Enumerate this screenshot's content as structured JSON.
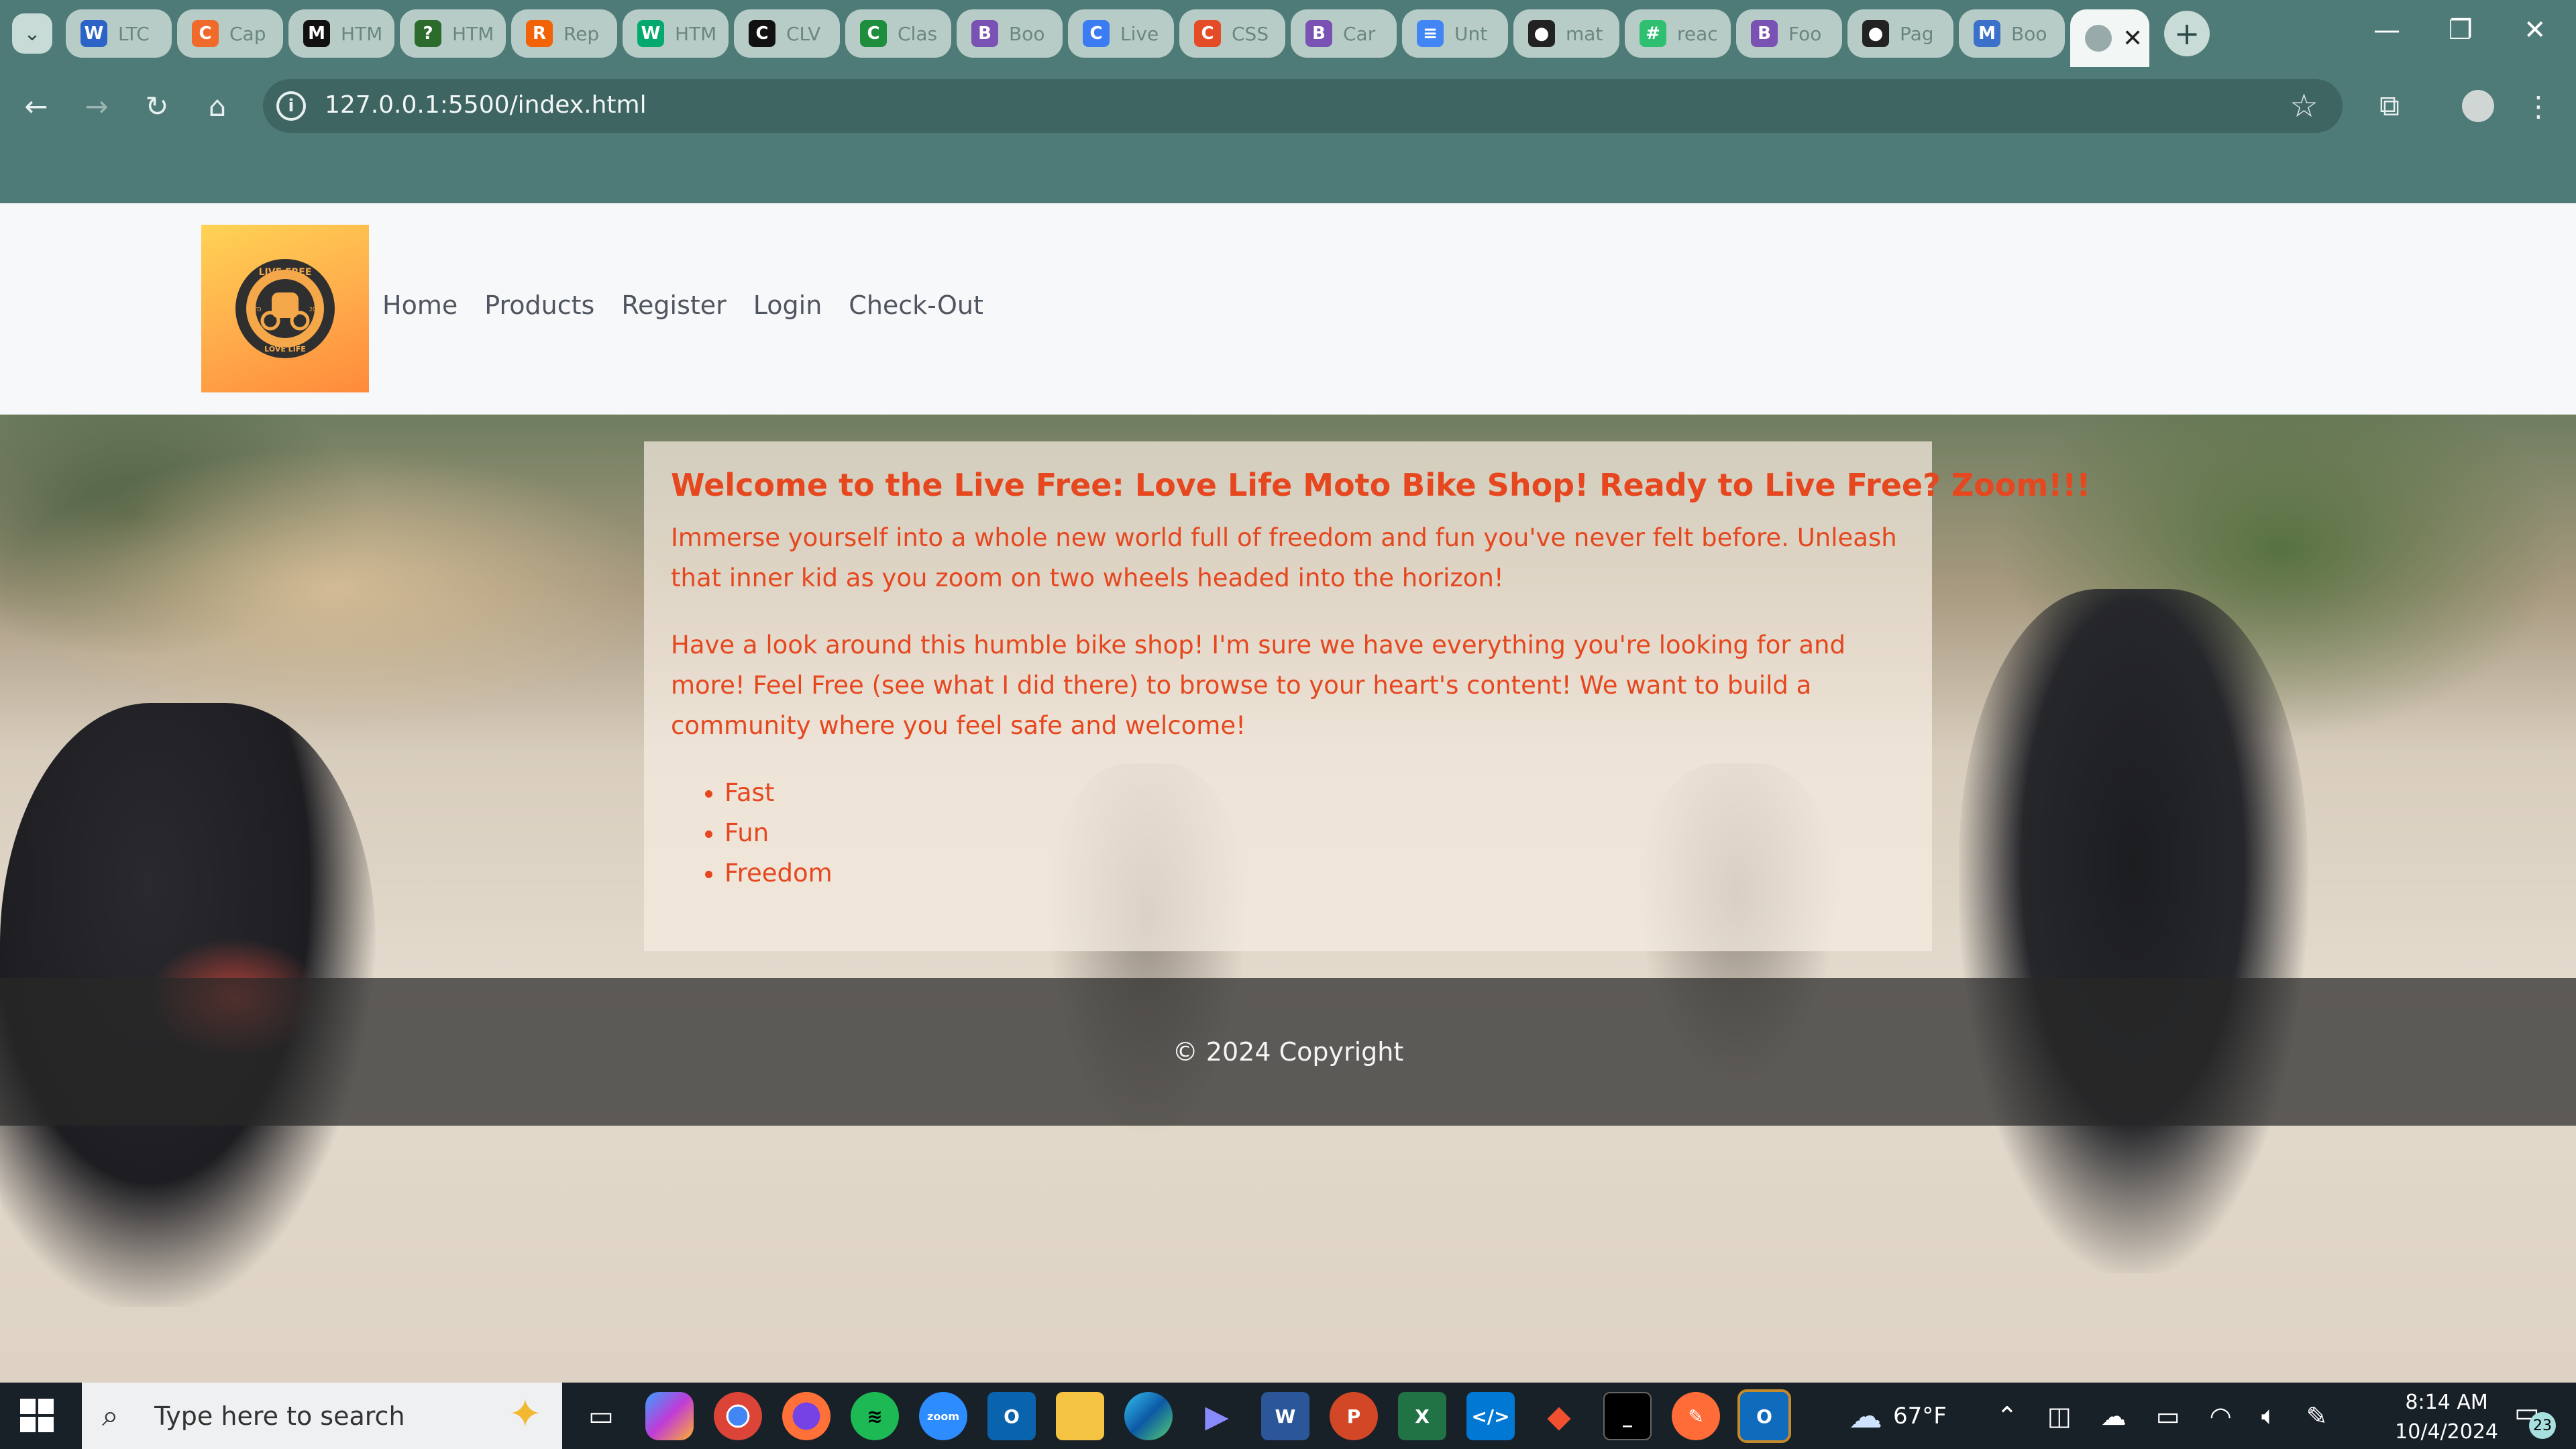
{
  "browser": {
    "tabs": [
      {
        "label": "LTC",
        "icon": "word-icon",
        "color": "#2b63c6",
        "glyph": "W"
      },
      {
        "label": "Cap",
        "icon": "codecademy-icon",
        "color": "#f06a2b",
        "glyph": "C"
      },
      {
        "label": "HTM",
        "icon": "m-icon",
        "color": "#111111",
        "glyph": "M"
      },
      {
        "label": "HTM",
        "icon": "question-icon",
        "color": "#2d6b2d",
        "glyph": "?"
      },
      {
        "label": "Rep",
        "icon": "replit-icon",
        "color": "#f26207",
        "glyph": "R"
      },
      {
        "label": "HTM",
        "icon": "w3schools-icon",
        "color": "#04aa6d",
        "glyph": "W"
      },
      {
        "label": "CLV",
        "icon": "clv-icon",
        "color": "#111111",
        "glyph": "C"
      },
      {
        "label": "Clas",
        "icon": "classroom-icon",
        "color": "#1e8e3e",
        "glyph": "C"
      },
      {
        "label": "Boo",
        "icon": "bootstrap-icon",
        "color": "#7952b3",
        "glyph": "B"
      },
      {
        "label": "Live",
        "icon": "canva-icon",
        "color": "#3c7cf2",
        "glyph": "C"
      },
      {
        "label": "CSS",
        "icon": "css-icon",
        "color": "#e34c26",
        "glyph": "C"
      },
      {
        "label": "Car",
        "icon": "bootstrap-icon",
        "color": "#7952b3",
        "glyph": "B"
      },
      {
        "label": "Unt",
        "icon": "docs-icon",
        "color": "#4285f4",
        "glyph": "≡"
      },
      {
        "label": "mat",
        "icon": "github-icon",
        "color": "#222222",
        "glyph": "●"
      },
      {
        "label": "reac",
        "icon": "react-icon",
        "color": "#2fbf71",
        "glyph": "#"
      },
      {
        "label": "Foo",
        "icon": "bootstrap-icon",
        "color": "#7952b3",
        "glyph": "B"
      },
      {
        "label": "Pag",
        "icon": "github-icon",
        "color": "#222222",
        "glyph": "●"
      },
      {
        "label": "Boo",
        "icon": "mdb-icon",
        "color": "#3b71ca",
        "glyph": "M"
      }
    ],
    "address": "127.0.0.1:5500/index.html"
  },
  "site": {
    "nav": [
      "Home",
      "Products",
      "Register",
      "Login",
      "Check-Out"
    ],
    "logo_text_top": "LIVE FREE",
    "logo_text_bottom": "LOVE LIFE",
    "logo_estd": "ESTD",
    "logo_year": "2024",
    "heading": "Welcome to the Live Free: Love Life Moto Bike Shop! Ready to Live Free? Zoom!!!",
    "paragraph1": "Immerse yourself into a whole new world full of freedom and fun you've never felt before. Unleash that inner kid as you zoom on two wheels headed into the horizon!",
    "paragraph2": "Have a look around this humble bike shop! I'm sure we have everything you're looking for and more! Feel Free (see what I did there) to browse to your heart's content! We want to build a community where you feel safe and welcome!",
    "features": [
      "Fast",
      "Fun",
      "Freedom"
    ],
    "footer": "© 2024 Copyright",
    "text_color": "#e6471f"
  },
  "taskbar": {
    "search_placeholder": "Type here to search",
    "weather": "67°F",
    "time": "8:14 AM",
    "date": "10/4/2024",
    "notifications": "23"
  }
}
